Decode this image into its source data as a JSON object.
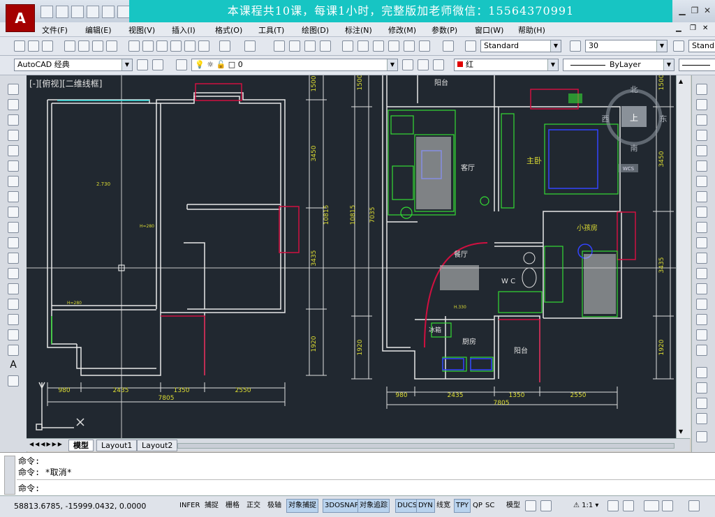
{
  "title_bar": {
    "promo_text": "本课程共10课，每课1小时，完整版加老师微信：15564370991",
    "logo_letter": "A"
  },
  "menu": [
    "文件(F)",
    "编辑(E)",
    "视图(V)",
    "插入(I)",
    "格式(O)",
    "工具(T)",
    "绘图(D)",
    "标注(N)",
    "修改(M)",
    "参数(P)",
    "窗口(W)",
    "帮助(H)"
  ],
  "toolbar": {
    "text_style": "Standard",
    "dim_scale": "30",
    "dim_style": "Stand"
  },
  "layer_bar": {
    "workspace": "AutoCAD 经典",
    "layer": "0",
    "color": "红",
    "linetype": "ByLayer"
  },
  "viewport": {
    "label": "[-][俯视][二维线框]",
    "compass": {
      "north": "北",
      "south": "南",
      "east": "东",
      "west": "西",
      "top": "上",
      "wcs": "WCS"
    }
  },
  "drawing": {
    "left_dims": [
      "980",
      "2435",
      "1350",
      "2550"
    ],
    "left_total": "7805",
    "right_dims": [
      "980",
      "2435",
      "1350",
      "2550"
    ],
    "right_total": "7805",
    "vertical_dims_left_plan": [
      "1500",
      "3450",
      "10815",
      "3435",
      "1920"
    ],
    "vertical_dims_right_plan": [
      "1500",
      "7035",
      "10815",
      "1920"
    ],
    "vertical_dims_far_right": [
      "1500",
      "3450",
      "3435",
      "1920"
    ],
    "rooms": [
      "阳台",
      "客厅",
      "主卧",
      "小孩房",
      "餐厅",
      "W C",
      "厨房",
      "阳台",
      "冰箱"
    ],
    "small_labels": [
      "2.730",
      "H=280",
      "H=280",
      "H.330"
    ]
  },
  "tabs": [
    "模型",
    "Layout1",
    "Layout2"
  ],
  "command": {
    "line1": "命令:",
    "line2": "命令: *取消*",
    "line3": "命令:"
  },
  "status": {
    "coords": "58813.6785, -15999.0432, 0.0000",
    "buttons": [
      "INFER",
      "捕捉",
      "栅格",
      "正交",
      "极轴",
      "对象捕捉",
      "3DOSNAP",
      "对象追踪",
      "DUCS",
      "DYN",
      "线宽",
      "TPY",
      "QP",
      "SC"
    ],
    "model_label": "模型",
    "anno_scale": "1:1"
  }
}
